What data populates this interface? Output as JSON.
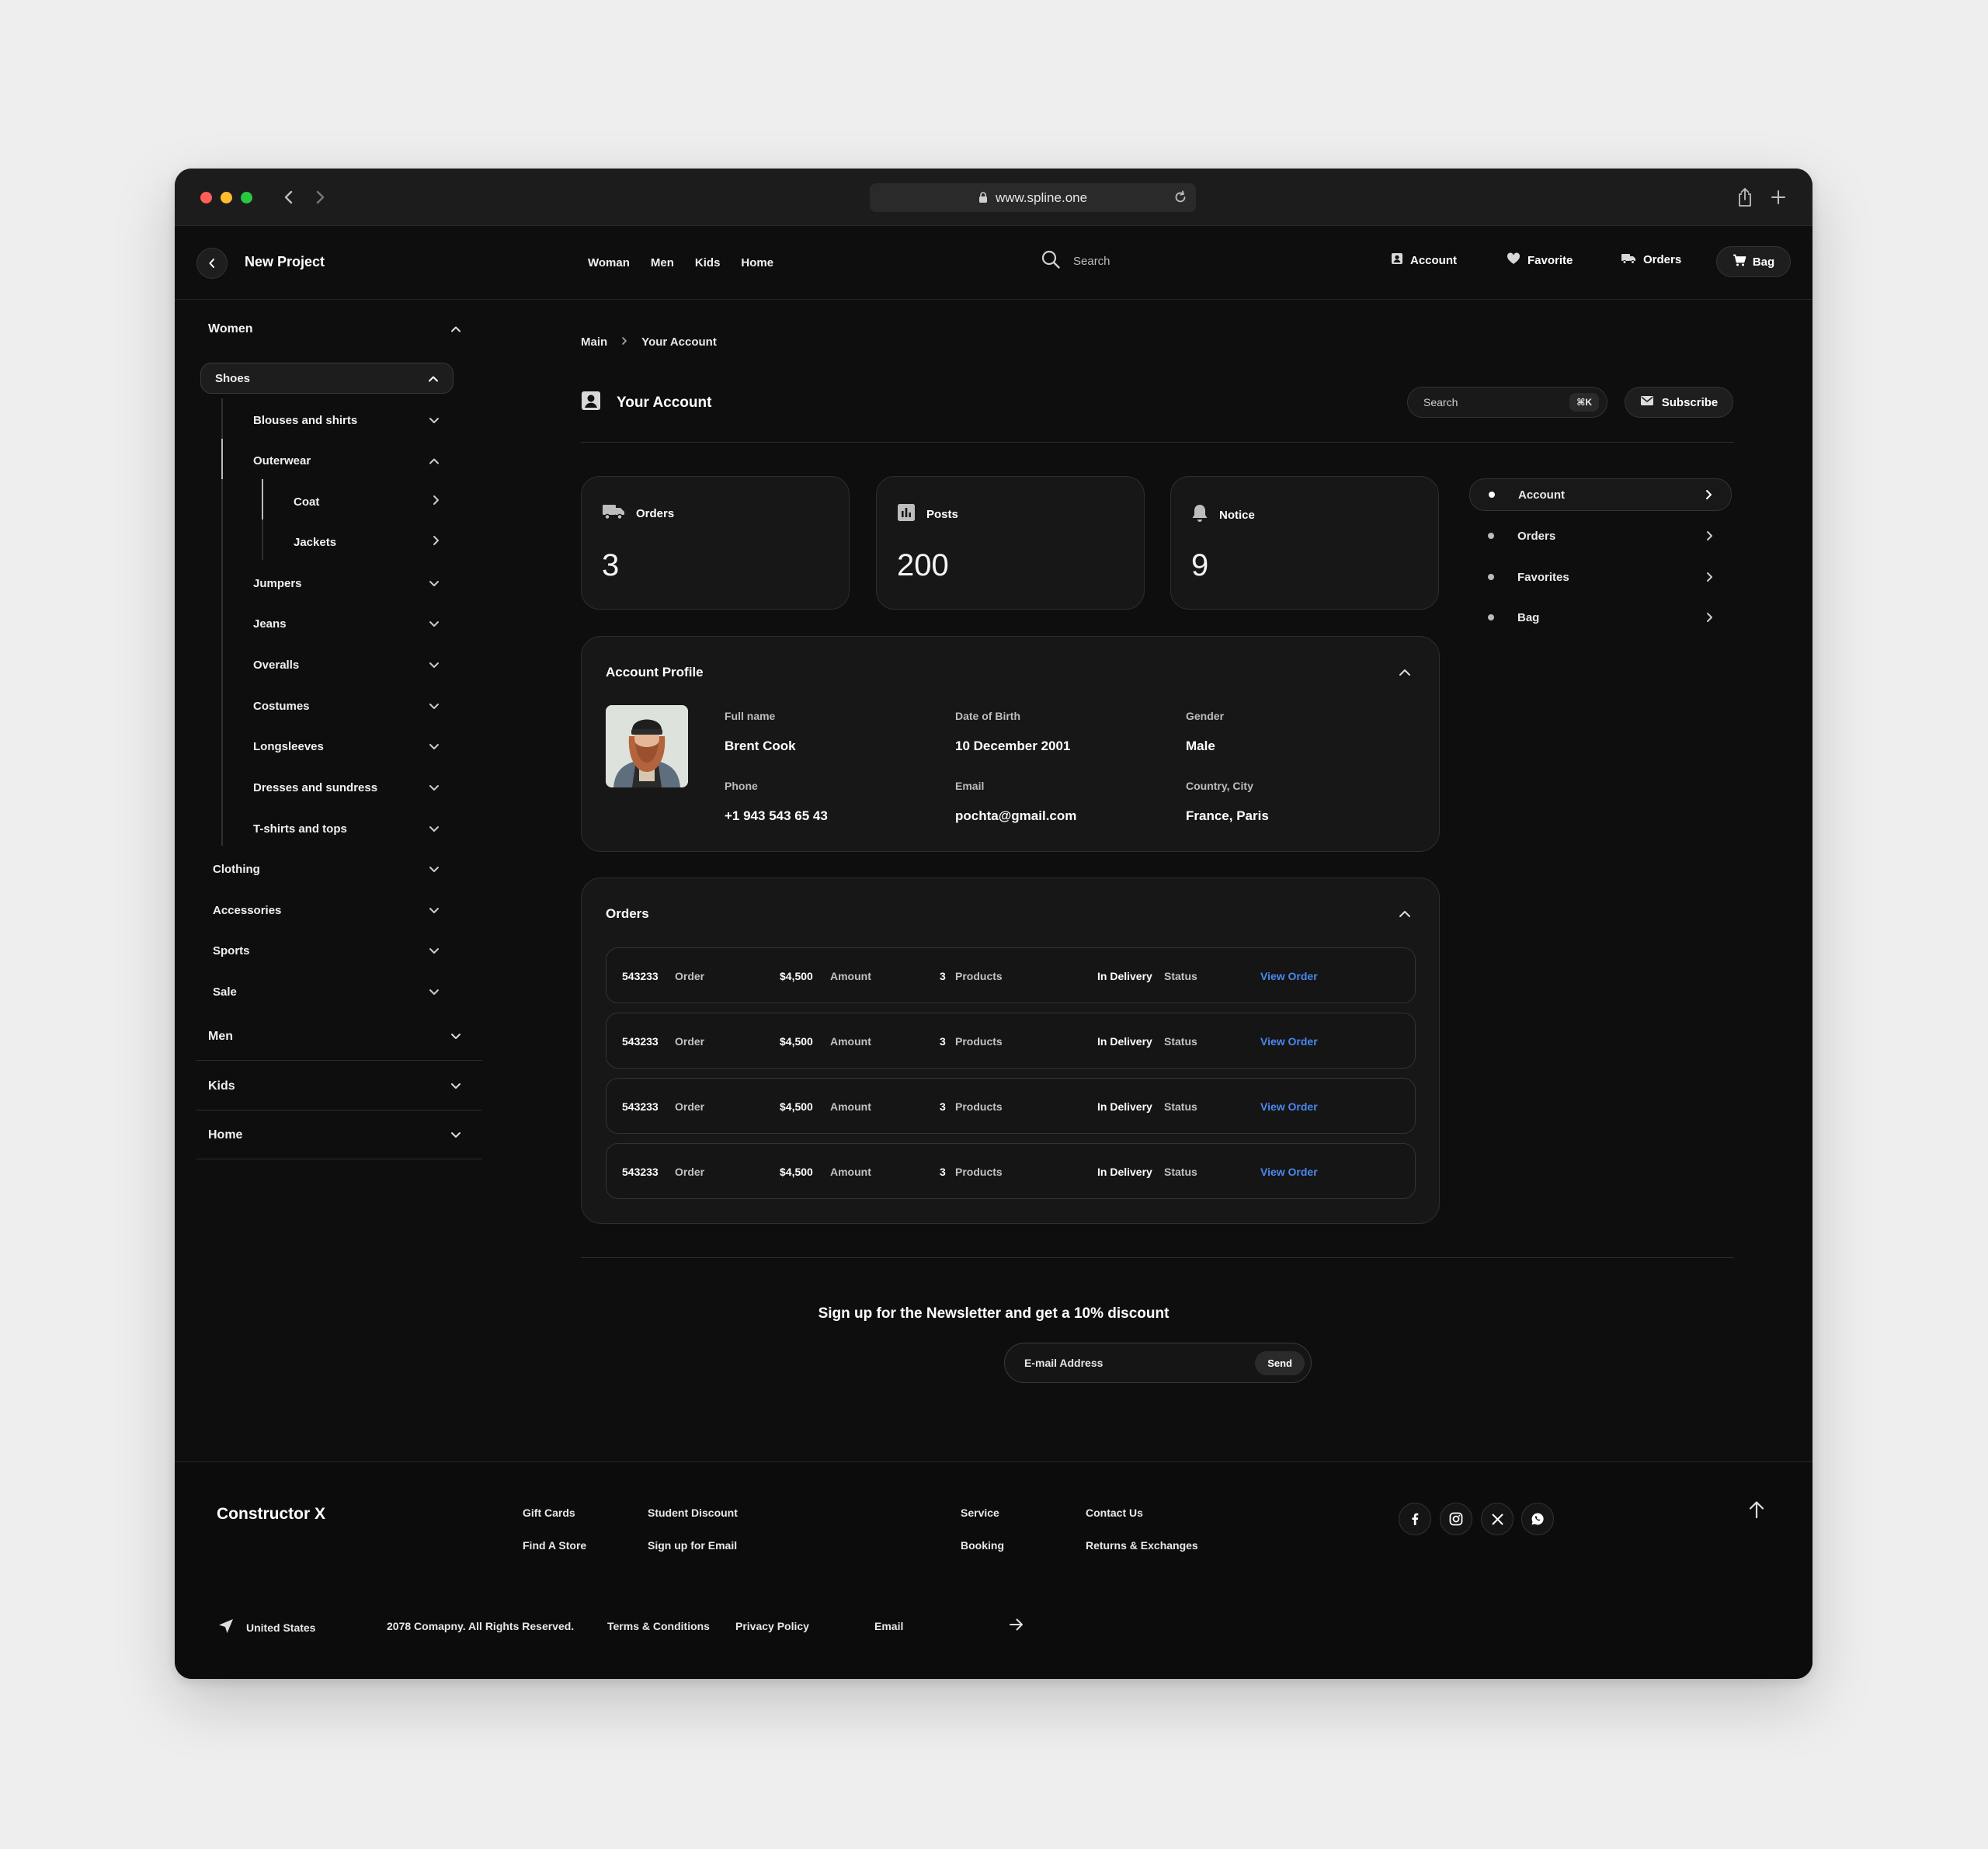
{
  "browser": {
    "url": "www.spline.one"
  },
  "header": {
    "project": "New Project",
    "nav": [
      "Woman",
      "Men",
      "Kids",
      "Home"
    ],
    "search_placeholder": "Search",
    "account": "Account",
    "favorite": "Favorite",
    "orders": "Orders",
    "bag": "Bag"
  },
  "sidebar": {
    "women": "Women",
    "shoes": "Shoes",
    "blouses": "Blouses and shirts",
    "outerwear": "Outerwear",
    "coat": "Coat",
    "jackets": "Jackets",
    "jumpers": "Jumpers",
    "jeans": "Jeans",
    "overalls": "Overalls",
    "costumes": "Costumes",
    "longsleeves": "Longsleeves",
    "dresses": "Dresses and sundress",
    "tshirts": "T-shirts and tops",
    "clothing": "Clothing",
    "accessories": "Accessories",
    "sports": "Sports",
    "sale": "Sale",
    "men": "Men",
    "kids": "Kids",
    "home": "Home"
  },
  "breadcrumb": {
    "main": "Main",
    "current": "Your Account"
  },
  "page": {
    "title": "Your Account",
    "search_placeholder": "Search",
    "search_shortcut": "⌘K",
    "subscribe": "Subscribe"
  },
  "stats": [
    {
      "label": "Orders",
      "value": "3"
    },
    {
      "label": "Posts",
      "value": "200"
    },
    {
      "label": "Notice",
      "value": "9"
    }
  ],
  "profile": {
    "title": "Account Profile",
    "fullname_label": "Full name",
    "fullname": "Brent Cook",
    "dob_label": "Date of Birth",
    "dob": "10 December 2001",
    "gender_label": "Gender",
    "gender": "Male",
    "phone_label": "Phone",
    "phone": "+1 943 543 65 43",
    "email_label": "Email",
    "email": "pochta@gmail.com",
    "location_label": "Country, City",
    "location": "France, Paris"
  },
  "orders": {
    "title": "Orders",
    "rows": [
      {
        "id": "543233",
        "id_label": "Order",
        "amount": "$4,500",
        "amount_label": "Amount",
        "qty": "3",
        "qty_label": "Products",
        "status": "In Delivery",
        "status_label": "Status",
        "link": "View Order"
      },
      {
        "id": "543233",
        "id_label": "Order",
        "amount": "$4,500",
        "amount_label": "Amount",
        "qty": "3",
        "qty_label": "Products",
        "status": "In Delivery",
        "status_label": "Status",
        "link": "View Order"
      },
      {
        "id": "543233",
        "id_label": "Order",
        "amount": "$4,500",
        "amount_label": "Amount",
        "qty": "3",
        "qty_label": "Products",
        "status": "In Delivery",
        "status_label": "Status",
        "link": "View Order"
      },
      {
        "id": "543233",
        "id_label": "Order",
        "amount": "$4,500",
        "amount_label": "Amount",
        "qty": "3",
        "qty_label": "Products",
        "status": "In Delivery",
        "status_label": "Status",
        "link": "View Order"
      }
    ]
  },
  "right_nav": [
    "Account",
    "Orders",
    "Favorites",
    "Bag"
  ],
  "newsletter": {
    "title": "Sign up for the Newsletter and get a 10% discount",
    "placeholder": "E-mail Address",
    "send": "Send"
  },
  "footer": {
    "brand": "Constructor X",
    "gift_cards": "Gift Cards",
    "find_store": "Find A Store",
    "student": "Student Discount",
    "signup_email": "Sign up for Email",
    "service": "Service",
    "booking": "Booking",
    "contact": "Contact Us",
    "returns": "Returns & Exchanges",
    "country": "United States",
    "copyright": "2078 Comapny. All Rights Reserved.",
    "terms": "Terms & Conditions",
    "privacy": "Privacy Policy",
    "email": "Email"
  },
  "colors": {
    "background": "#0e0e0e",
    "card": "#171717",
    "link": "#4a88f0"
  }
}
